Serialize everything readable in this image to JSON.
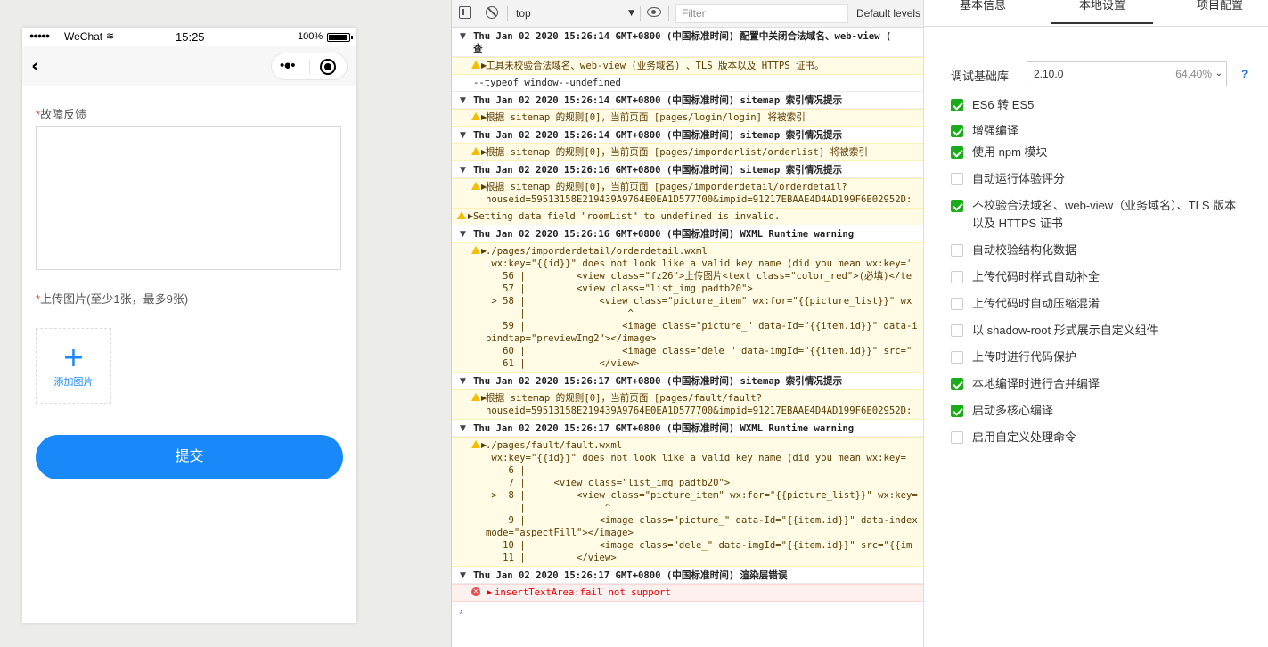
{
  "simulator": {
    "status": {
      "carrier": "WeChat",
      "time": "15:25",
      "battery": "100%"
    },
    "form": {
      "fault_label": "故障反馈",
      "required_mark": "*",
      "upload_label": "上传图片(至少1张，最多9张)",
      "add_image_label": "添加图片",
      "submit_label": "提交"
    }
  },
  "console": {
    "context": "top",
    "filter_placeholder": "Filter",
    "levels_label": "Default levels",
    "entries": [
      {
        "type": "group",
        "text": "Thu Jan 02 2020 15:26:14 GMT+0800 (中国标准时间) 配置中关闭合法域名、web-view (\n查"
      },
      {
        "type": "warn",
        "text": "工具未校验合法域名、web-view (业务域名) 、TLS 版本以及 HTTPS 证书。"
      },
      {
        "type": "plain",
        "text": "--typeof window--undefined"
      },
      {
        "type": "group",
        "text": "Thu Jan 02 2020 15:26:14 GMT+0800 (中国标准时间) sitemap 索引情况提示"
      },
      {
        "type": "warn",
        "text": "根据 sitemap 的规则[0]，当前页面 [pages/login/login] 将被索引"
      },
      {
        "type": "group",
        "text": "Thu Jan 02 2020 15:26:14 GMT+0800 (中国标准时间) sitemap 索引情况提示"
      },
      {
        "type": "warn",
        "text": "根据 sitemap 的规则[0]，当前页面 [pages/imporderlist/orderlist] 将被索引"
      },
      {
        "type": "group",
        "text": "Thu Jan 02 2020 15:26:16 GMT+0800 (中国标准时间) sitemap 索引情况提示"
      },
      {
        "type": "warn",
        "text": "根据 sitemap 的规则[0]，当前页面 [pages/imporderdetail/orderdetail?\nhouseid=59513158E219439A9764E0EA1D577700&impid=91217EBAAE4D4AD199F6E02952D:"
      },
      {
        "type": "warnflat",
        "text": "Setting data field \"roomList\" to undefined is invalid."
      },
      {
        "type": "group",
        "text": "Thu Jan 02 2020 15:26:16 GMT+0800 (中国标准时间) WXML Runtime warning"
      },
      {
        "type": "warn",
        "text": "./pages/imporderdetail/orderdetail.wxml\n wx:key=\"{{id}}\" does not look like a valid key name (did you mean wx:key='\n   56 |         <view class=\"fz26\">上传图片<text class=\"color_red\">(必填)</te\n   57 |         <view class=\"list_img padtb20\">\n > 58 |             <view class=\"picture_item\" wx:for=\"{{picture_list}}\" wx\n      |                  ^\n   59 |                 <image class=\"picture_\" data-Id=\"{{item.id}}\" data-i\nbindtap=\"previewImg2\"></image>\n   60 |                 <image class=\"dele_\" data-imgId=\"{{item.id}}\" src=\"\n   61 |             </view>"
      },
      {
        "type": "group",
        "text": "Thu Jan 02 2020 15:26:17 GMT+0800 (中国标准时间) sitemap 索引情况提示"
      },
      {
        "type": "warn",
        "text": "根据 sitemap 的规则[0]，当前页面 [pages/fault/fault?\nhouseid=59513158E219439A9764E0EA1D577700&impid=91217EBAAE4D4AD199F6E02952D:"
      },
      {
        "type": "group",
        "text": "Thu Jan 02 2020 15:26:17 GMT+0800 (中国标准时间) WXML Runtime warning"
      },
      {
        "type": "warn",
        "text": "./pages/fault/fault.wxml\n wx:key=\"{{id}}\" does not look like a valid key name (did you mean wx:key=\n    6 |\n    7 |     <view class=\"list_img padtb20\">\n >  8 |         <view class=\"picture_item\" wx:for=\"{{picture_list}}\" wx:key=\n      |              ^\n    9 |             <image class=\"picture_\" data-Id=\"{{item.id}}\" data-index\nmode=\"aspectFill\"></image>\n   10 |             <image class=\"dele_\" data-imgId=\"{{item.id}}\" src=\"{{im\n   11 |         </view>"
      },
      {
        "type": "group",
        "text": "Thu Jan 02 2020 15:26:17 GMT+0800 (中国标准时间) 渲染层错误"
      },
      {
        "type": "error",
        "text": "insertTextArea:fail not support"
      }
    ]
  },
  "settings": {
    "tabs": [
      "基本信息",
      "本地设置",
      "项目配置"
    ],
    "active_tab": "本地设置",
    "base_lib_label": "调试基础库",
    "base_lib_version": "2.10.0",
    "base_lib_percent": "64.40%",
    "help_label": "?",
    "options": [
      {
        "label": "ES6 转 ES5",
        "checked": true
      },
      {
        "label": "增强编译",
        "checked": true
      },
      {
        "label": "使用 npm 模块",
        "checked": true
      },
      {
        "label": "自动运行体验评分",
        "checked": false
      },
      {
        "label": "不校验合法域名、web-view（业务域名）、TLS 版本以及 HTTPS 证书",
        "checked": true
      },
      {
        "label": "自动校验结构化数据",
        "checked": false
      },
      {
        "label": "上传代码时样式自动补全",
        "checked": false
      },
      {
        "label": "上传代码时自动压缩混淆",
        "checked": false
      },
      {
        "label": "以 shadow-root 形式展示自定义组件",
        "checked": false
      },
      {
        "label": "上传时进行代码保护",
        "checked": false
      },
      {
        "label": "本地编译时进行合并编译",
        "checked": true
      },
      {
        "label": "启动多核心编译",
        "checked": true
      },
      {
        "label": "启用自定义处理命令",
        "checked": false
      }
    ]
  }
}
